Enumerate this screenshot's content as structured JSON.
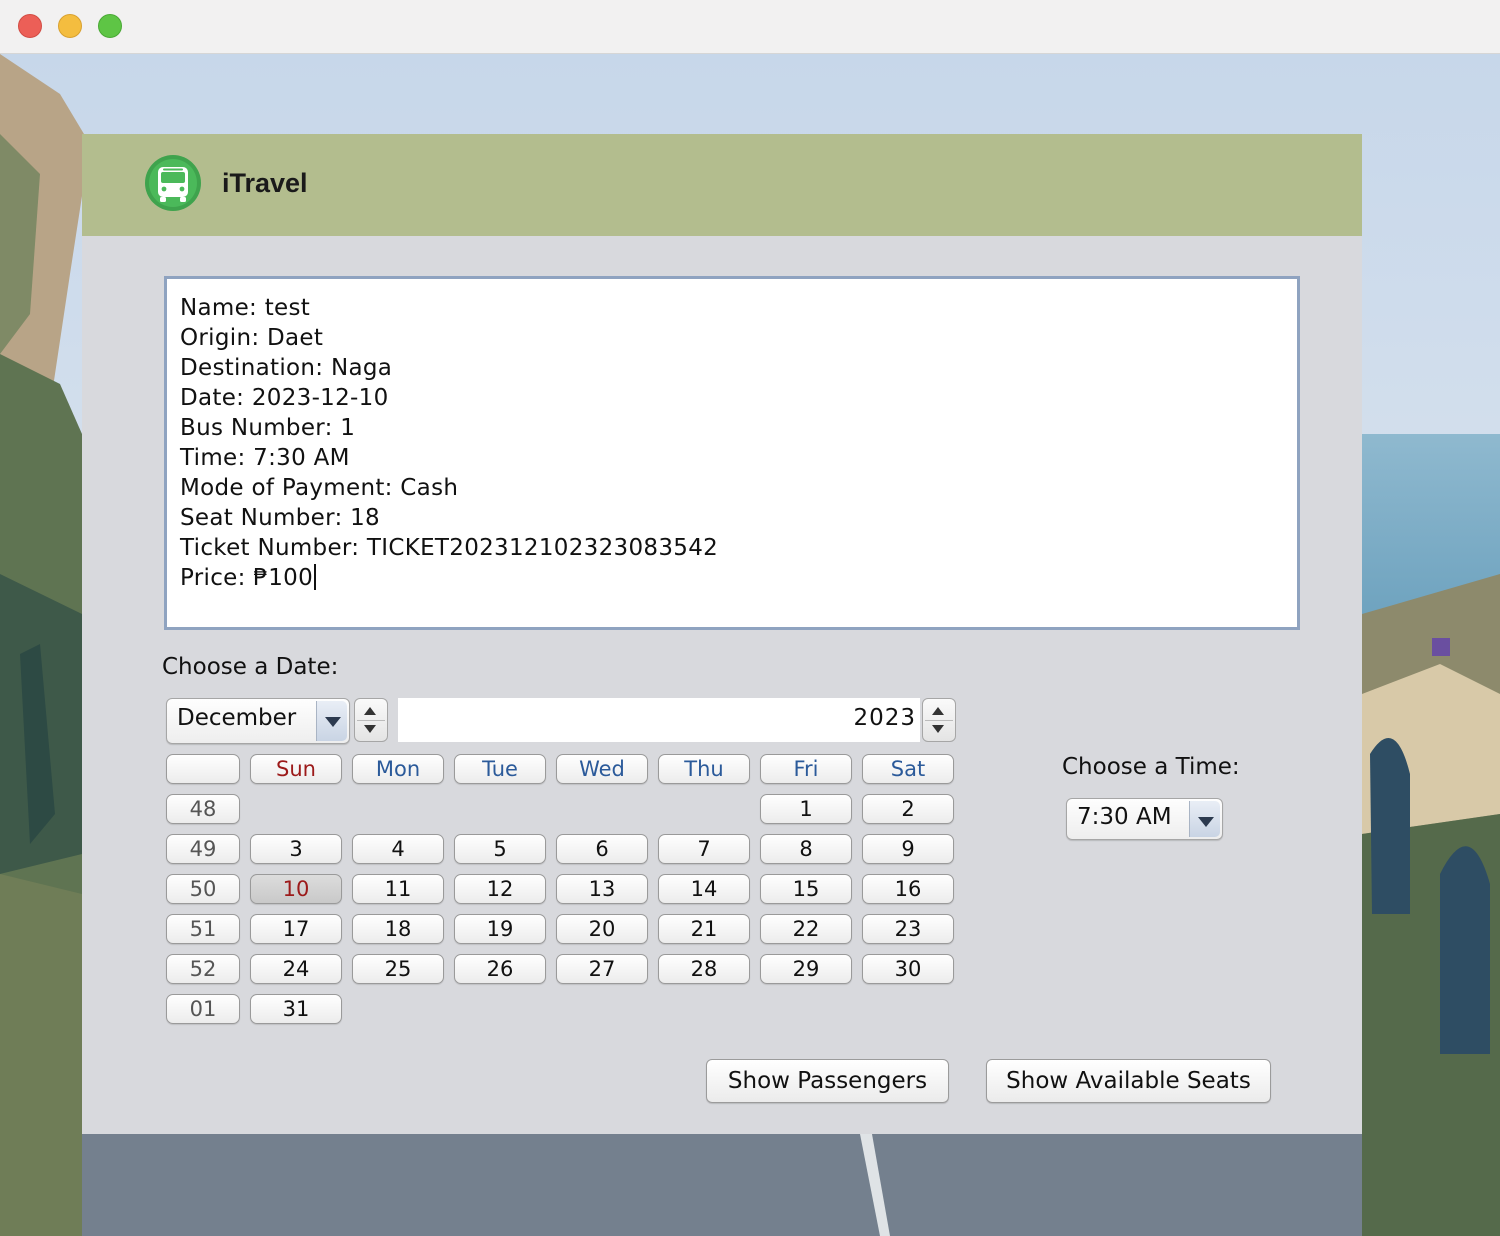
{
  "app": {
    "title": "iTravel",
    "logo_icon": "bus-icon",
    "brand_color": "#b3bd8e"
  },
  "ticket": {
    "lines": [
      "Name: test",
      "Origin: Daet",
      "Destination: Naga",
      "Date: 2023-12-10",
      "Bus Number: 1",
      "Time: 7:30 AM",
      "Mode of Payment: Cash",
      "Seat Number: 18",
      "Ticket Number: TICKET20231210232308354​2",
      "Price: ₱100"
    ]
  },
  "date_chooser": {
    "label": "Choose a Date:",
    "month": "December",
    "year": "2023",
    "weekday_headers": [
      "Sun",
      "Mon",
      "Tue",
      "Wed",
      "Thu",
      "Fri",
      "Sat"
    ],
    "week_numbers": [
      "48",
      "49",
      "50",
      "51",
      "52",
      "01"
    ],
    "days": [
      [
        "",
        "",
        "",
        "",
        "",
        "1",
        "2"
      ],
      [
        "3",
        "4",
        "5",
        "6",
        "7",
        "8",
        "9"
      ],
      [
        "10",
        "11",
        "12",
        "13",
        "14",
        "15",
        "16"
      ],
      [
        "17",
        "18",
        "19",
        "20",
        "21",
        "22",
        "23"
      ],
      [
        "24",
        "25",
        "26",
        "27",
        "28",
        "29",
        "30"
      ],
      [
        "31",
        "",
        "",
        "",
        "",
        "",
        ""
      ]
    ],
    "selected_day": "10"
  },
  "time_chooser": {
    "label": "Choose a Time:",
    "value": "7:30 AM"
  },
  "buttons": {
    "show_passengers": "Show Passengers",
    "show_available_seats": "Show Available Seats"
  }
}
